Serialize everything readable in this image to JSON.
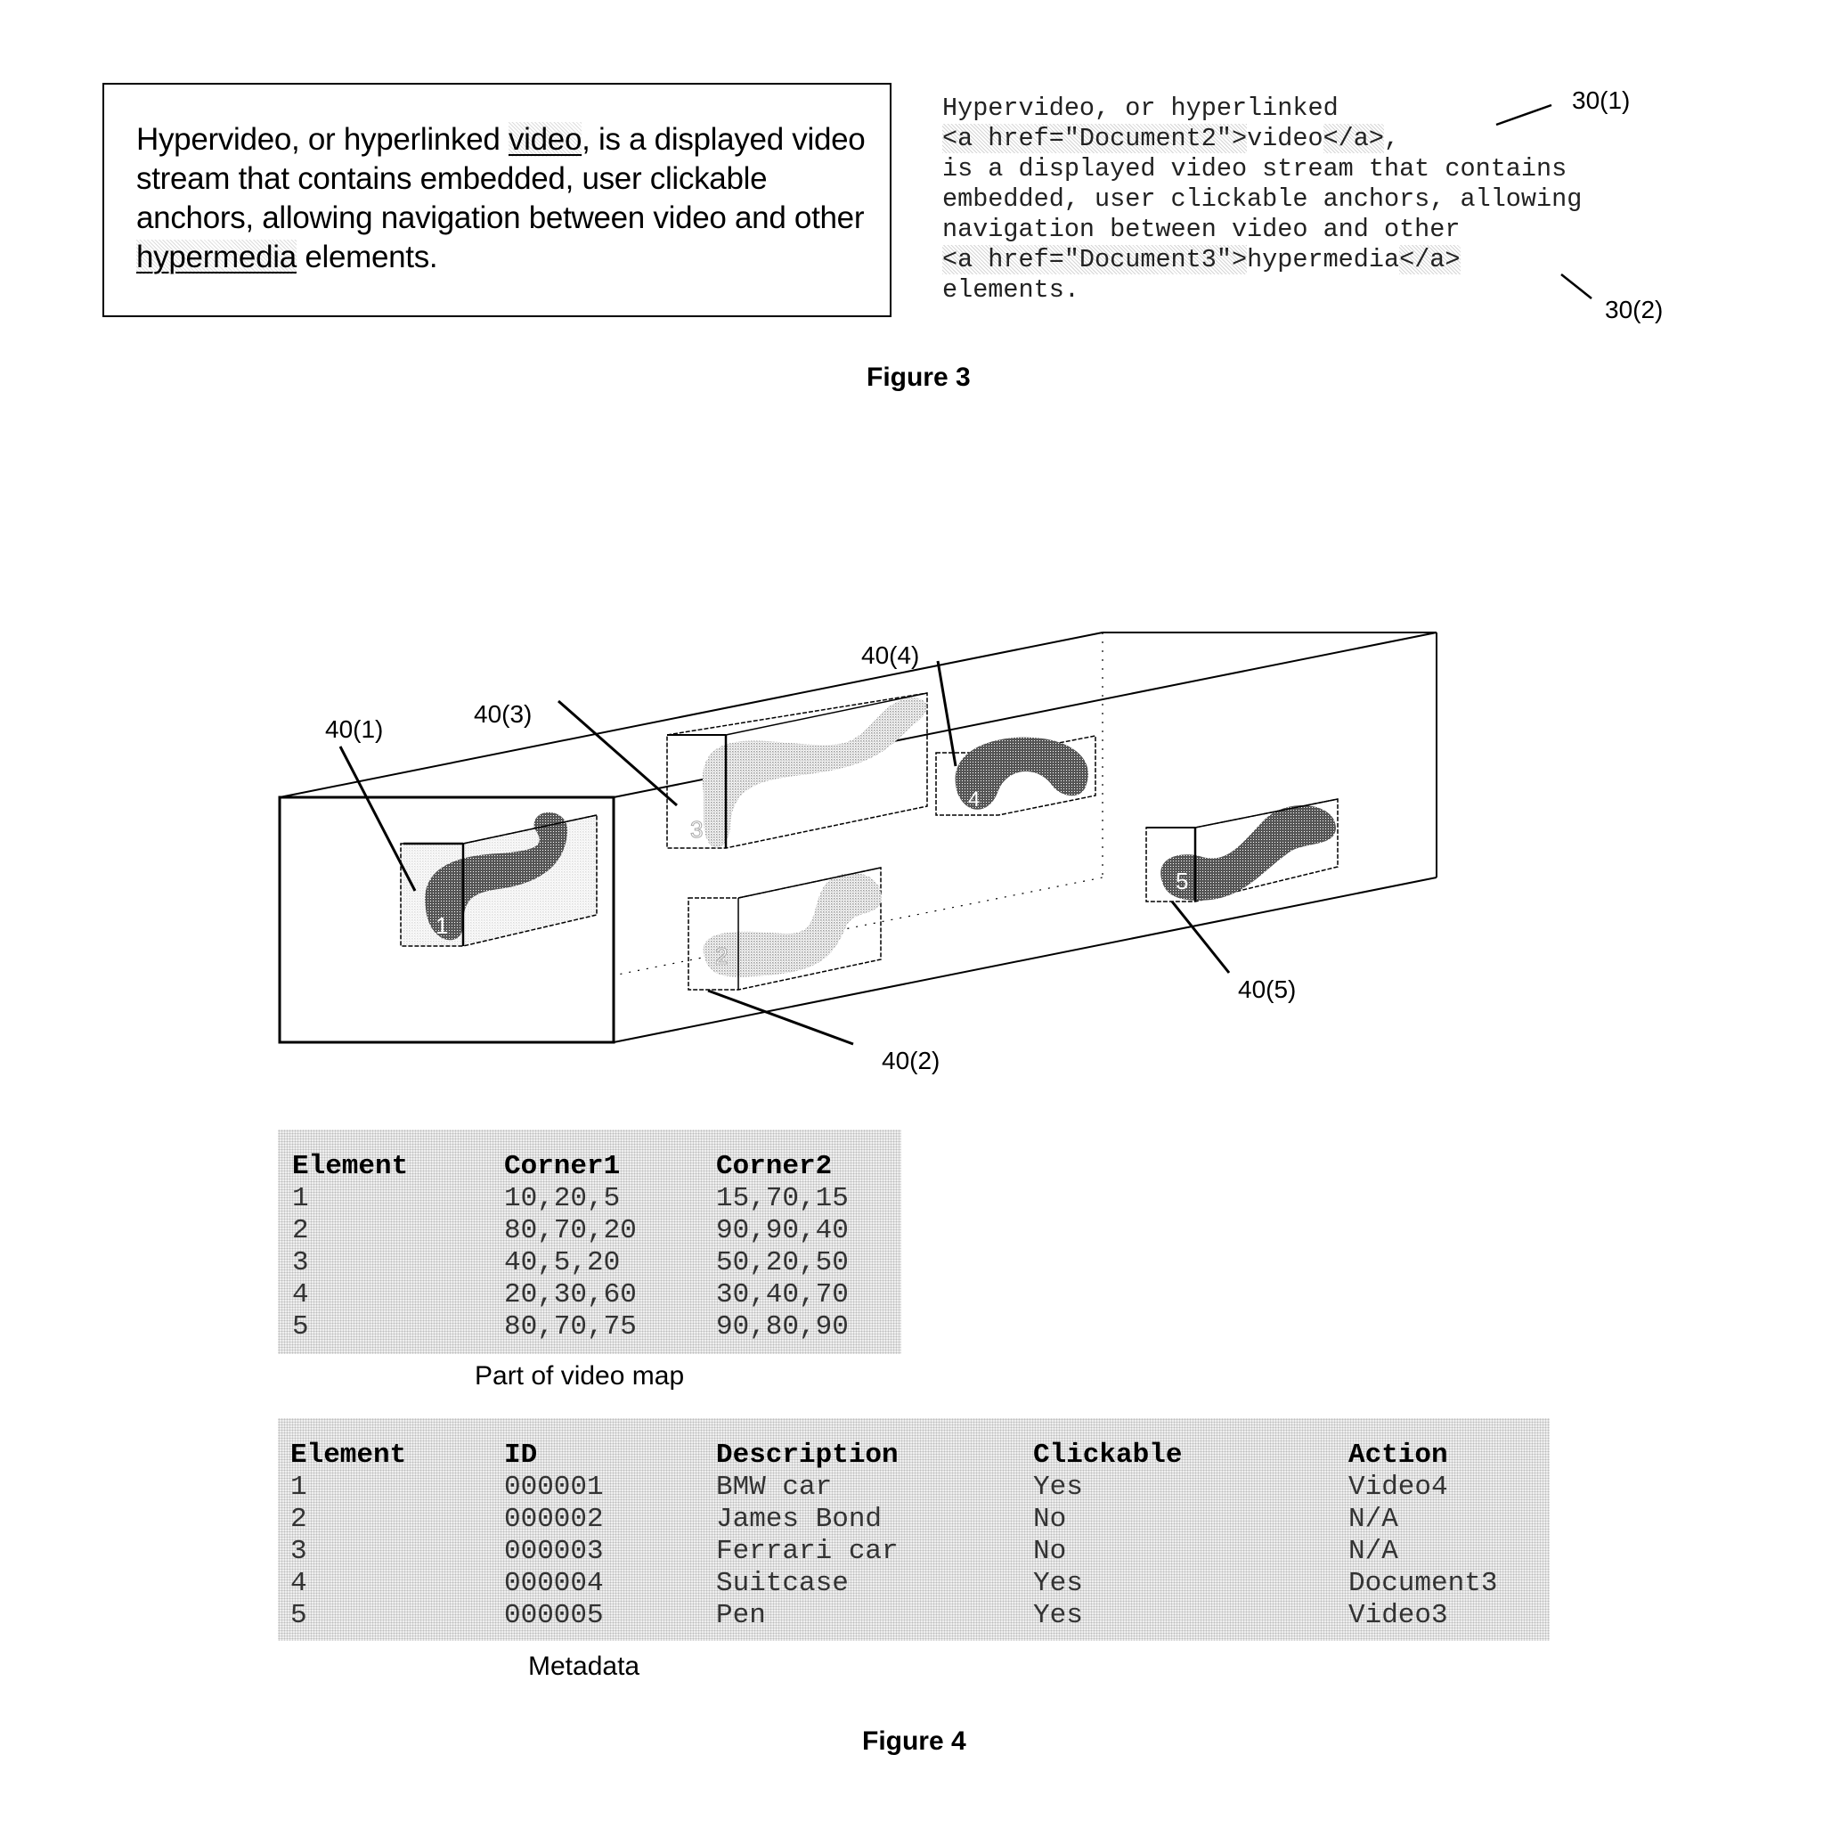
{
  "figure3": {
    "caption": "Figure 3",
    "rendered_text": {
      "part1": "Hypervideo, or hyperlinked ",
      "link1": "video",
      "part2": ", is a displayed video stream that contains embedded, user clickable anchors, allowing navigation between video and other ",
      "link2": "hypermedia",
      "part3": " elements."
    },
    "source_lines": [
      {
        "plain": "Hypervideo, or hyperlinked",
        "hl": ""
      },
      {
        "plain": "",
        "hl": "<a href=\"Document2\">",
        "after": "video",
        "hl2": "</a>",
        "tail": ","
      },
      {
        "plain": "is a displayed video stream that contains",
        "hl": ""
      },
      {
        "plain": "embedded, user clickable anchors, allowing",
        "hl": ""
      },
      {
        "plain": "navigation between video and other",
        "hl": ""
      },
      {
        "plain": "",
        "hl": "<a href=\"Document3\">",
        "after": "hypermedia",
        "hl2": "</a>",
        "tail": ""
      },
      {
        "plain": "elements.",
        "hl": ""
      }
    ],
    "ref_labels": {
      "anchor1": "30(1)",
      "anchor2": "30(2)"
    }
  },
  "figure4": {
    "caption": "Figure 4",
    "ref_labels": {
      "el1": "40(1)",
      "el2": "40(2)",
      "el3": "40(3)",
      "el4": "40(4)",
      "el5": "40(5)"
    },
    "object_numbers": [
      "1",
      "2",
      "3",
      "4",
      "5"
    ],
    "video_map": {
      "caption": "Part of video map",
      "headers": [
        "Element",
        "Corner1",
        "Corner2"
      ],
      "rows": [
        [
          "1",
          "10,20,5",
          "15,70,15"
        ],
        [
          "2",
          "80,70,20",
          "90,90,40"
        ],
        [
          "3",
          "40,5,20",
          "50,20,50"
        ],
        [
          "4",
          "20,30,60",
          "30,40,70"
        ],
        [
          "5",
          "80,70,75",
          "90,80,90"
        ]
      ]
    },
    "metadata": {
      "caption": "Metadata",
      "headers": [
        "Element",
        "ID",
        "Description",
        "Clickable",
        "Action"
      ],
      "rows": [
        [
          "1",
          "000001",
          "BMW car",
          "Yes",
          "Video4"
        ],
        [
          "2",
          "000002",
          "James Bond",
          "No",
          "N/A"
        ],
        [
          "3",
          "000003",
          "Ferrari car",
          "No",
          "N/A"
        ],
        [
          "4",
          "000004",
          "Suitcase",
          "Yes",
          "Document3"
        ],
        [
          "5",
          "000005",
          "Pen",
          "Yes",
          "Video3"
        ]
      ]
    }
  }
}
